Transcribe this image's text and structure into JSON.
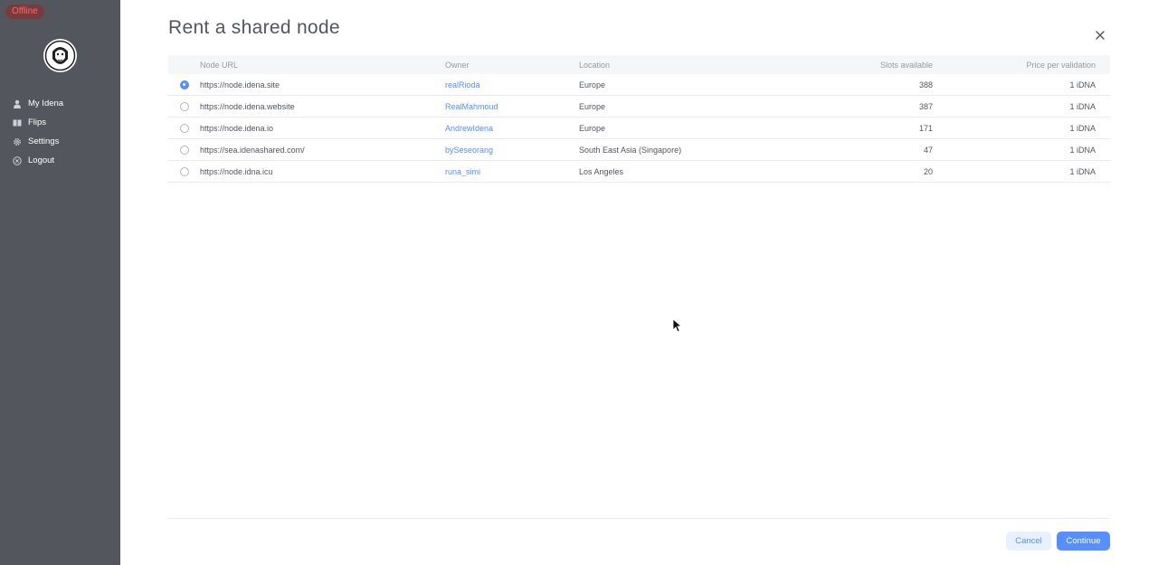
{
  "sidebar": {
    "status": "Offline",
    "nav": [
      {
        "label": "My Idena",
        "icon": "user-icon"
      },
      {
        "label": "Flips",
        "icon": "flips-icon"
      },
      {
        "label": "Settings",
        "icon": "gear-icon"
      },
      {
        "label": "Logout",
        "icon": "logout-icon"
      }
    ]
  },
  "dialog": {
    "title": "Rent a shared node",
    "columns": {
      "url": "Node URL",
      "owner": "Owner",
      "location": "Location",
      "slots": "Slots available",
      "price": "Price per validation"
    },
    "rows": [
      {
        "url": "https://node.idena.site",
        "owner": "realRioda",
        "location": "Europe",
        "slots": "388",
        "price": "1 iDNA",
        "selected": true
      },
      {
        "url": "https://node.idena.website",
        "owner": "RealMahmoud",
        "location": "Europe",
        "slots": "387",
        "price": "1 iDNA",
        "selected": false
      },
      {
        "url": "https://node.idena.io",
        "owner": "AndrewIdena",
        "location": "Europe",
        "slots": "171",
        "price": "1 iDNA",
        "selected": false
      },
      {
        "url": "https://sea.idenashared.com/",
        "owner": "bySeseorang",
        "location": "South East Asia (Singapore)",
        "slots": "47",
        "price": "1 iDNA",
        "selected": false
      },
      {
        "url": "https://node.idna.icu",
        "owner": "runa_simi",
        "location": "Los Angeles",
        "slots": "20",
        "price": "1 iDNA",
        "selected": false
      }
    ],
    "cancel_label": "Cancel",
    "continue_label": "Continue"
  },
  "colors": {
    "sidebar_bg": "#53565c",
    "accent": "#578fff",
    "offline": "#ff6666"
  }
}
